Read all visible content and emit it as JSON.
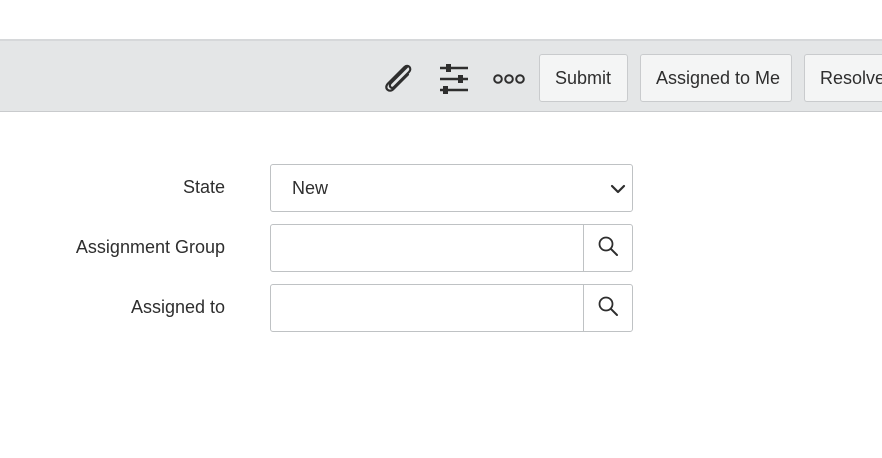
{
  "toolbar": {
    "icons": {
      "attachment": "paperclip-icon",
      "personalize": "sliders-icon",
      "more": "more-options-icon"
    },
    "buttons": {
      "submit": "Submit",
      "assigned_to_me": "Assigned to Me",
      "resolve": "Resolve"
    }
  },
  "form": {
    "state": {
      "label": "State",
      "value": "New"
    },
    "assignment_group": {
      "label": "Assignment Group",
      "value": "",
      "lookup_icon": "search-icon"
    },
    "assigned_to": {
      "label": "Assigned to",
      "value": "",
      "lookup_icon": "search-icon"
    }
  }
}
